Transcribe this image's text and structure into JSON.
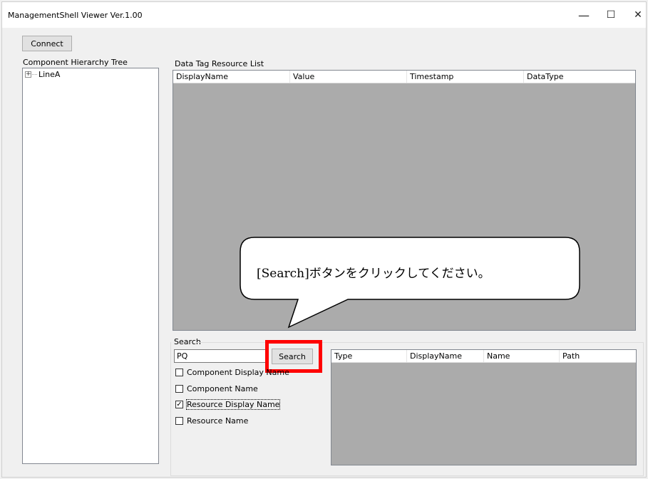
{
  "window": {
    "title": "ManagementShell Viewer Ver.1.00",
    "minimize_glyph": "—",
    "maximize_glyph": "☐",
    "close_glyph": "✕"
  },
  "toolbar": {
    "connect_label": "Connect"
  },
  "tree": {
    "label": "Component Hierarchy Tree",
    "nodes": [
      {
        "label": "LineA",
        "expander": "+"
      }
    ]
  },
  "data_tags": {
    "label": "Data Tag Resource List",
    "columns": [
      "DisplayName",
      "Value",
      "Timestamp",
      "DataType"
    ]
  },
  "callout": {
    "text": "[Search]ボタンをクリックしてください。"
  },
  "search": {
    "group_label": "Search",
    "query_value": "PQ",
    "button_label": "Search",
    "options": [
      {
        "label": "Component Display Name",
        "checked": false
      },
      {
        "label": "Component Name",
        "checked": false
      },
      {
        "label": "Resource Display Name",
        "checked": true
      },
      {
        "label": "Resource Name",
        "checked": false
      }
    ],
    "check_glyph": "✓",
    "results_columns": [
      "Type",
      "DisplayName",
      "Name",
      "Path"
    ]
  },
  "colors": {
    "highlight": "#ff0000",
    "grid_background": "#ababab"
  }
}
